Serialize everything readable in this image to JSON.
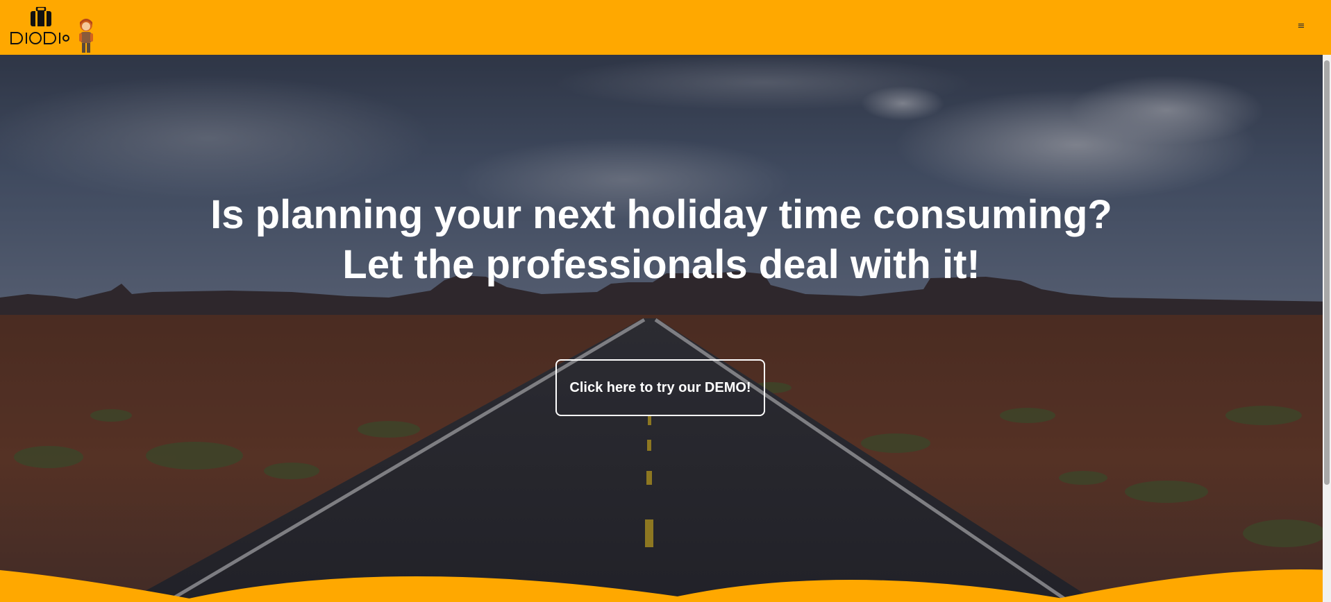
{
  "header": {
    "logo_text": "DIODIO",
    "menu_icon": "hamburger-icon",
    "menu_glyph": "≡"
  },
  "hero": {
    "title_line1": "Is planning your next holiday time consuming?",
    "title_line2": "Let the professionals deal with it!",
    "cta_label": "Click here to try our DEMO!"
  },
  "colors": {
    "brand": "#ffa800",
    "hero_text": "#ffffff"
  }
}
